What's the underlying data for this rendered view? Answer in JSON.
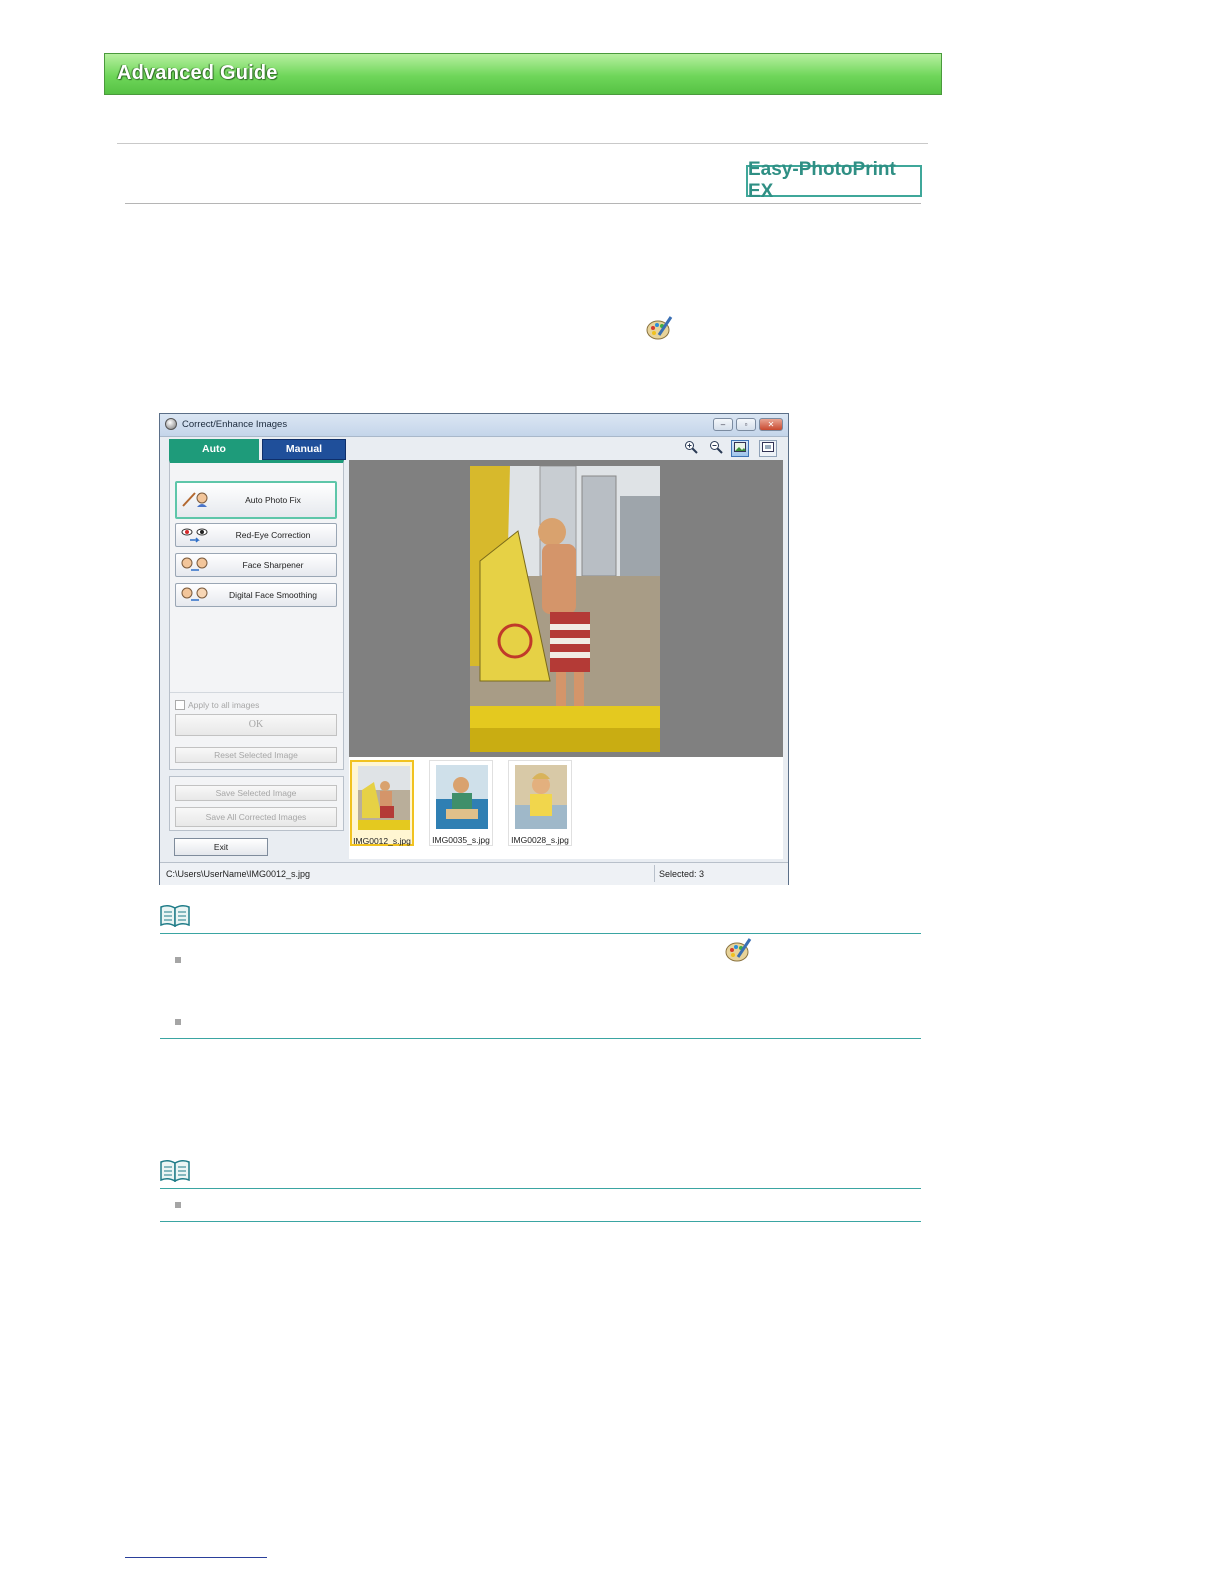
{
  "header": {
    "title": "Advanced Guide"
  },
  "product_badge": "Easy-PhotoPrint EX",
  "icons": {
    "correct_enhance": "palette-brush-icon",
    "note": "open-book-icon"
  },
  "window": {
    "title": "Correct/Enhance Images",
    "tabs": [
      {
        "label": "Auto",
        "active": true
      },
      {
        "label": "Manual",
        "active": false
      }
    ],
    "auto_buttons": [
      {
        "label": "Auto Photo Fix"
      },
      {
        "label": "Red-Eye Correction"
      },
      {
        "label": "Face Sharpener"
      },
      {
        "label": "Digital Face Smoothing"
      }
    ],
    "apply_all_label": "Apply to all images",
    "ok_label": "OK",
    "reset_label": "Reset Selected Image",
    "save_selected_label": "Save Selected Image",
    "save_all_label": "Save All Corrected Images",
    "exit_label": "Exit",
    "toolbar": [
      "zoom-in-icon",
      "zoom-out-icon",
      "whole-image-icon",
      "full-screen-icon"
    ],
    "thumbnails": [
      {
        "name": "IMG0012_s.jpg",
        "selected": true
      },
      {
        "name": "IMG0035_s.jpg",
        "selected": false
      },
      {
        "name": "IMG0028_s.jpg",
        "selected": false
      }
    ],
    "status_path": "C:\\Users\\UserName\\IMG0012_s.jpg",
    "status_selected": "Selected: 3"
  },
  "colors": {
    "banner_green": "#6fd65a",
    "auto_tab": "#1e9b7a",
    "manual_tab": "#1f4f9a",
    "note_rule": "#3aa5a2",
    "badge": "#2f8f84"
  }
}
